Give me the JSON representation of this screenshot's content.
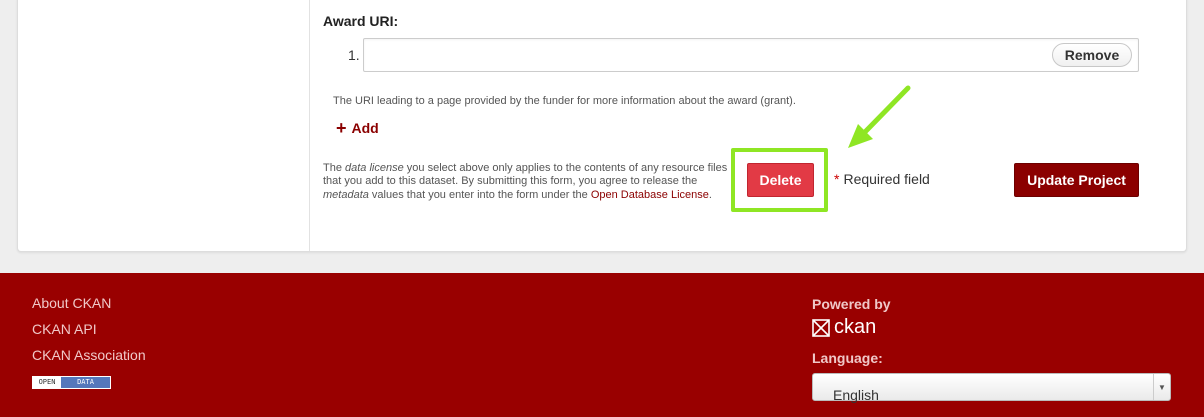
{
  "form": {
    "award_uri_label": "Award URI:",
    "item_number": "1.",
    "uri_value": "",
    "remove_label": "Remove",
    "help_text": "The URI leading to a page provided by the funder for more information about the award (grant).",
    "add_label": "Add",
    "add_icon": "plus-icon",
    "license": {
      "part1": "The ",
      "em1": "data license",
      "part2": " you select above only applies to the contents of any resource files that you add to this dataset. By submitting this form, you agree to release the ",
      "em2": "metadata",
      "part3": " values that you enter into the form under the ",
      "link": "Open Database License",
      "part4": "."
    },
    "delete_label": "Delete",
    "required_star": "*",
    "required_text": "Required field",
    "update_label": "Update Project",
    "highlight_color": "#8fe624",
    "accent_color": "#8b0000",
    "delete_color": "#e23a45"
  },
  "footer": {
    "links": [
      "About CKAN",
      "CKAN API",
      "CKAN Association"
    ],
    "badge_left": "OPEN",
    "badge_right": "DATA",
    "powered_by": "Powered by",
    "logo_text": "ckan",
    "language_label": "Language:",
    "language_value": "English",
    "background_color": "#990000"
  }
}
